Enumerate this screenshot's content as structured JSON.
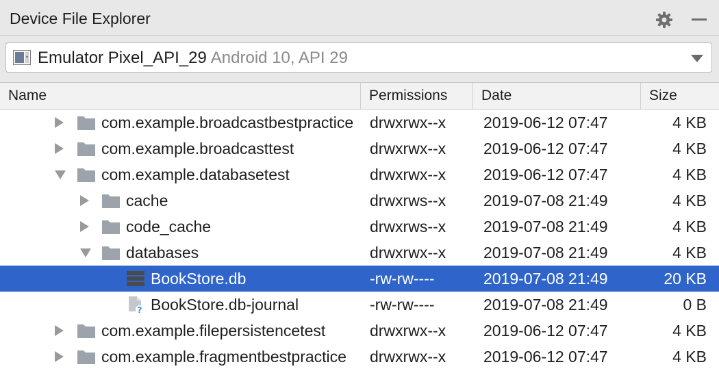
{
  "panel": {
    "title": "Device File Explorer",
    "settings_icon": "gear-icon",
    "minimize_icon": "minimize-icon"
  },
  "device": {
    "icon": "emulator-icon",
    "name": "Emulator Pixel_API_29",
    "detail": "Android 10, API 29"
  },
  "columns": {
    "name": "Name",
    "permissions": "Permissions",
    "date": "Date",
    "size": "Size"
  },
  "rows": [
    {
      "name": "com.example.broadcastbestpractice",
      "permissions": "drwxrwx--x",
      "date": "2019-06-12 07:47",
      "size": "4 KB",
      "type": "folder",
      "expanded": false,
      "depth": 0
    },
    {
      "name": "com.example.broadcasttest",
      "permissions": "drwxrwx--x",
      "date": "2019-06-12 07:47",
      "size": "4 KB",
      "type": "folder",
      "expanded": false,
      "depth": 0
    },
    {
      "name": "com.example.databasetest",
      "permissions": "drwxrwx--x",
      "date": "2019-06-12 07:47",
      "size": "4 KB",
      "type": "folder",
      "expanded": true,
      "depth": 0
    },
    {
      "name": "cache",
      "permissions": "drwxrws--x",
      "date": "2019-07-08 21:49",
      "size": "4 KB",
      "type": "folder",
      "expanded": false,
      "depth": 1
    },
    {
      "name": "code_cache",
      "permissions": "drwxrws--x",
      "date": "2019-07-08 21:49",
      "size": "4 KB",
      "type": "folder",
      "expanded": false,
      "depth": 1
    },
    {
      "name": "databases",
      "permissions": "drwxrwx--x",
      "date": "2019-07-08 21:49",
      "size": "4 KB",
      "type": "folder",
      "expanded": true,
      "depth": 1
    },
    {
      "name": "BookStore.db",
      "permissions": "-rw-rw----",
      "date": "2019-07-08 21:49",
      "size": "20 KB",
      "type": "database",
      "selected": true,
      "depth": 2
    },
    {
      "name": "BookStore.db-journal",
      "permissions": "-rw-rw----",
      "date": "2019-07-08 21:49",
      "size": "0 B",
      "type": "unknown-file",
      "depth": 2
    },
    {
      "name": "com.example.filepersistencetest",
      "permissions": "drwxrwx--x",
      "date": "2019-06-12 07:47",
      "size": "4 KB",
      "type": "folder",
      "expanded": false,
      "depth": 0
    },
    {
      "name": "com.example.fragmentbestpractice",
      "permissions": "drwxrwx--x",
      "date": "2019-06-12 07:47",
      "size": "4 KB",
      "type": "folder",
      "expanded": false,
      "depth": 0
    }
  ],
  "colors": {
    "selection": "#2f65ca",
    "folder": "#9da3aa",
    "arrow": "#9a9a9a",
    "secondary_text": "#8a8a8a"
  }
}
